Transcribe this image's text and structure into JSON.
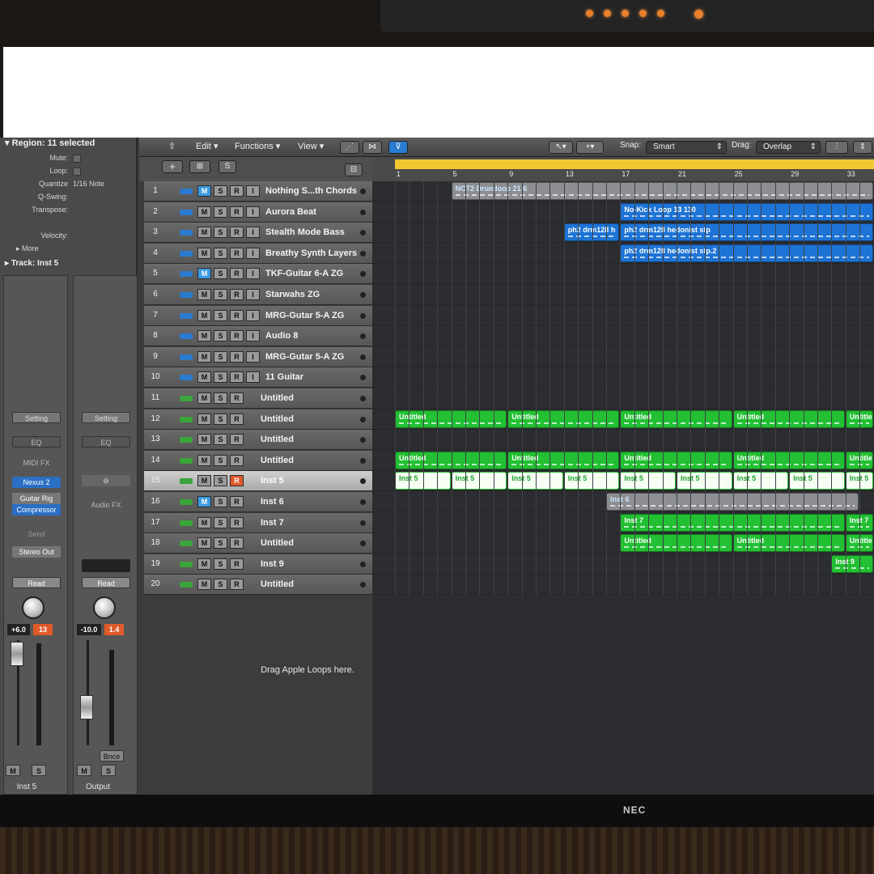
{
  "inspector": {
    "region_header": "Region: 11 selected",
    "fields": [
      {
        "label": "Mute:",
        "value": ""
      },
      {
        "label": "Loop:",
        "value": ""
      },
      {
        "label": "Quantize",
        "value": "1/16 Note"
      },
      {
        "label": "Q-Swing:",
        "value": ""
      },
      {
        "label": "Transpose:",
        "value": ""
      },
      {
        "label": "Velocity:",
        "value": ""
      }
    ],
    "more_label": "More",
    "track_header": "Track: Inst 5",
    "strip_left": {
      "setting": "Setting",
      "eq": "EQ",
      "midi_fx": "MIDI FX",
      "instrument": "Nexus 2",
      "insert1": "Guitar Rig",
      "insert2": "Compressor",
      "send": "Send",
      "output": "Stereo Out",
      "automation": "Read",
      "volume": "+6.0",
      "peak": "13",
      "mute": "M",
      "solo": "S",
      "name": "Inst 5"
    },
    "strip_right": {
      "setting": "Setting",
      "eq": "EQ",
      "audio_fx": "Audio FX",
      "automation": "Read",
      "volume": "-10.0",
      "peak": "1.4",
      "bounce": "Bnce",
      "mute": "M",
      "solo": "S",
      "name": "Output"
    }
  },
  "toolbar": {
    "edit": "Edit",
    "functions": "Functions",
    "view": "View",
    "snap_label": "Snap:",
    "snap_value": "Smart",
    "drag_label": "Drag:",
    "drag_value": "Overlap"
  },
  "track_header": {
    "add": "+",
    "folder": "⊞",
    "s": "S"
  },
  "ruler": {
    "bars": [
      "1",
      "5",
      "9",
      "13",
      "17",
      "21",
      "25",
      "29",
      "33"
    ]
  },
  "tracks": [
    {
      "num": "1",
      "name": "Nothing S...th Chords",
      "type": "audio",
      "m_on": true,
      "s_on": false
    },
    {
      "num": "2",
      "name": "Aurora Beat",
      "type": "audio"
    },
    {
      "num": "3",
      "name": "Stealth Mode Bass",
      "type": "audio"
    },
    {
      "num": "4",
      "name": "Breathy Synth Layers",
      "type": "audio"
    },
    {
      "num": "5",
      "name": "TKF-Guitar 6-A ZG",
      "type": "audio",
      "m_on": true
    },
    {
      "num": "6",
      "name": "Starwahs ZG",
      "type": "audio"
    },
    {
      "num": "7",
      "name": "MRG-Gutar 5-A ZG",
      "type": "audio"
    },
    {
      "num": "8",
      "name": "Audio 8",
      "type": "audio"
    },
    {
      "num": "9",
      "name": "MRG-Gutar 5-A ZG",
      "type": "audio"
    },
    {
      "num": "10",
      "name": "11 Guitar",
      "type": "audio"
    },
    {
      "num": "11",
      "name": "Untitled",
      "type": "midi"
    },
    {
      "num": "12",
      "name": "Untitled",
      "type": "midi"
    },
    {
      "num": "13",
      "name": "Untitled",
      "type": "midi"
    },
    {
      "num": "14",
      "name": "Untitled",
      "type": "midi"
    },
    {
      "num": "15",
      "name": "Inst 5",
      "type": "midi",
      "rec_on": true,
      "selected": true
    },
    {
      "num": "16",
      "name": "Inst 6",
      "type": "midi",
      "m_on": true
    },
    {
      "num": "17",
      "name": "Inst 7",
      "type": "midi"
    },
    {
      "num": "18",
      "name": "Untitled",
      "type": "midi"
    },
    {
      "num": "19",
      "name": "Inst 9",
      "type": "midi"
    },
    {
      "num": "20",
      "name": "Untitled",
      "type": "midi"
    }
  ],
  "regions": [
    {
      "lane": 0,
      "start": 5,
      "end": 35,
      "label": "NCT2 Drumloop 21.6",
      "color": "gray"
    },
    {
      "lane": 1,
      "start": 17,
      "end": 35,
      "label": "No-Kick Loop 13 130",
      "color": "blue"
    },
    {
      "lane": 2,
      "start": 13,
      "end": 17,
      "label": "ph2 drm128 h",
      "color": "blue"
    },
    {
      "lane": 2,
      "start": 17,
      "end": 35,
      "label": "ph2 drm128 hedonist stp",
      "color": "blue"
    },
    {
      "lane": 3,
      "start": 17,
      "end": 35,
      "label": "ph2 drm128 hedonist stp.2",
      "color": "blue"
    },
    {
      "lane": 11,
      "start": 1,
      "end": 9,
      "label": "Untitled",
      "color": "green"
    },
    {
      "lane": 11,
      "start": 9,
      "end": 17,
      "label": "Untitled",
      "color": "green"
    },
    {
      "lane": 11,
      "start": 17,
      "end": 25,
      "label": "Untitled",
      "color": "green"
    },
    {
      "lane": 11,
      "start": 25,
      "end": 33,
      "label": "Untitled",
      "color": "green"
    },
    {
      "lane": 11,
      "start": 33,
      "end": 35,
      "label": "Untitled",
      "color": "green"
    },
    {
      "lane": 13,
      "start": 1,
      "end": 9,
      "label": "Untitled",
      "color": "green"
    },
    {
      "lane": 13,
      "start": 9,
      "end": 17,
      "label": "Untitled",
      "color": "green"
    },
    {
      "lane": 13,
      "start": 17,
      "end": 25,
      "label": "Untitled",
      "color": "green"
    },
    {
      "lane": 13,
      "start": 25,
      "end": 33,
      "label": "Untitled",
      "color": "green"
    },
    {
      "lane": 13,
      "start": 33,
      "end": 35,
      "label": "Untitled",
      "color": "green"
    },
    {
      "lane": 14,
      "start": 1,
      "end": 5,
      "label": "Inst 5",
      "color": "white"
    },
    {
      "lane": 14,
      "start": 5,
      "end": 9,
      "label": "Inst 5",
      "color": "white"
    },
    {
      "lane": 14,
      "start": 9,
      "end": 13,
      "label": "Inst 5",
      "color": "white"
    },
    {
      "lane": 14,
      "start": 13,
      "end": 17,
      "label": "Inst 5",
      "color": "white"
    },
    {
      "lane": 14,
      "start": 17,
      "end": 21,
      "label": "Inst 5",
      "color": "white"
    },
    {
      "lane": 14,
      "start": 21,
      "end": 25,
      "label": "Inst 5",
      "color": "white"
    },
    {
      "lane": 14,
      "start": 25,
      "end": 29,
      "label": "Inst 5",
      "color": "white"
    },
    {
      "lane": 14,
      "start": 29,
      "end": 33,
      "label": "Inst 5",
      "color": "white"
    },
    {
      "lane": 14,
      "start": 33,
      "end": 35,
      "label": "Inst 5",
      "color": "white"
    },
    {
      "lane": 15,
      "start": 16,
      "end": 34,
      "label": "Inst 6",
      "color": "gray"
    },
    {
      "lane": 16,
      "start": 17,
      "end": 33,
      "label": "Inst 7",
      "color": "green"
    },
    {
      "lane": 16,
      "start": 33,
      "end": 35,
      "label": "Inst 7",
      "color": "green"
    },
    {
      "lane": 17,
      "start": 17,
      "end": 25,
      "label": "Untitled",
      "color": "green"
    },
    {
      "lane": 17,
      "start": 25,
      "end": 33,
      "label": "Untitled",
      "color": "green"
    },
    {
      "lane": 17,
      "start": 33,
      "end": 35,
      "label": "Untitled",
      "color": "green"
    },
    {
      "lane": 18,
      "start": 32,
      "end": 35,
      "label": "Inst 9",
      "color": "green"
    }
  ],
  "drop_hint": "Drag Apple Loops here.",
  "monitor_brand": "NEC"
}
